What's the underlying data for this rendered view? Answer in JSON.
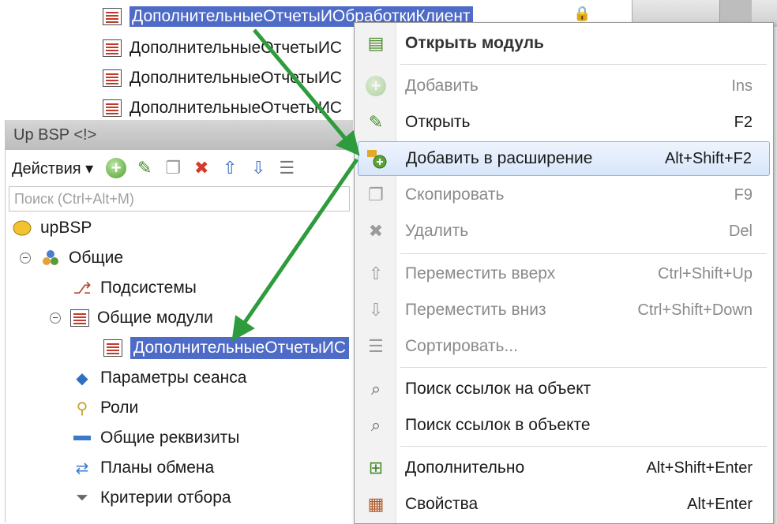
{
  "background_tree": {
    "rows": [
      {
        "label": "ДополнительныеОтчетыИОбработкиКлиент",
        "selected": true
      },
      {
        "label": "ДополнительныеОтчетыИС",
        "selected": false
      },
      {
        "label": "ДополнительныеОтчетыИС",
        "selected": false
      },
      {
        "label": "ДополнительныеОтчетыИС",
        "selected": false
      }
    ]
  },
  "panel": {
    "title": "Up BSP <!>",
    "toolbar": {
      "actions_label": "Действия ▾"
    },
    "search_placeholder": "Поиск (Ctrl+Alt+M)",
    "tree": {
      "root": "upBSP",
      "general": "Общие",
      "subsystems": "Подсистемы",
      "common_modules": "Общие модули",
      "selected_module": "ДополнительныеОтчетыИС",
      "session_params": "Параметры сеанса",
      "roles": "Роли",
      "common_attributes": "Общие реквизиты",
      "exchange_plans": "Планы обмена",
      "filter_criteria": "Критерии отбора"
    }
  },
  "context_menu": {
    "items": [
      {
        "label": "Открыть модуль",
        "shortcut": "",
        "icon": "open-module-icon"
      },
      {
        "label": "Добавить",
        "shortcut": "Ins",
        "icon": "add-icon"
      },
      {
        "label": "Открыть",
        "shortcut": "F2",
        "icon": "pencil-icon"
      },
      {
        "label": "Добавить в расширение",
        "shortcut": "Alt+Shift+F2",
        "icon": "add-to-extension-icon"
      },
      {
        "label": "Скопировать",
        "shortcut": "F9",
        "icon": "copy-icon"
      },
      {
        "label": "Удалить",
        "shortcut": "Del",
        "icon": "delete-icon"
      },
      {
        "label": "Переместить вверх",
        "shortcut": "Ctrl+Shift+Up",
        "icon": "arrow-up-icon"
      },
      {
        "label": "Переместить вниз",
        "shortcut": "Ctrl+Shift+Down",
        "icon": "arrow-down-icon"
      },
      {
        "label": "Сортировать...",
        "shortcut": "",
        "icon": "sort-icon"
      },
      {
        "label": "Поиск ссылок на объект",
        "shortcut": "",
        "icon": "find-refs-to-icon"
      },
      {
        "label": "Поиск ссылок в объекте",
        "shortcut": "",
        "icon": "find-refs-in-icon"
      },
      {
        "label": "Дополнительно",
        "shortcut": "Alt+Shift+Enter",
        "icon": "more-icon"
      },
      {
        "label": "Свойства",
        "shortcut": "Alt+Enter",
        "icon": "properties-icon"
      }
    ]
  },
  "colors": {
    "selection": "#4d6bc7",
    "arrow": "#2e9b3c",
    "menu_highlight_border": "#8fb2e6"
  }
}
